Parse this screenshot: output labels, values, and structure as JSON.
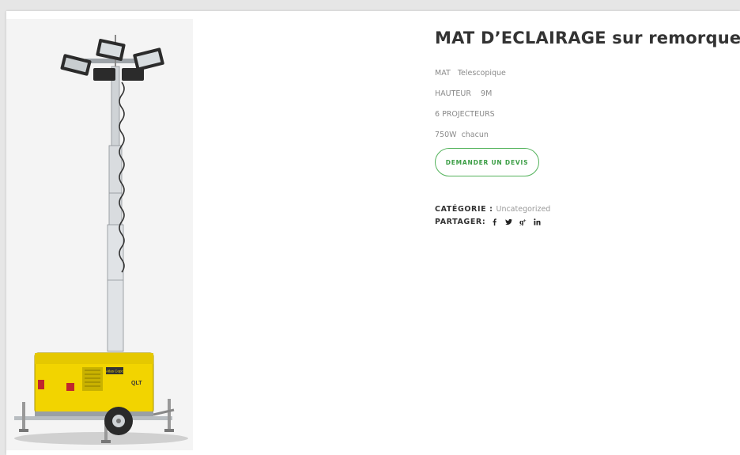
{
  "product": {
    "title": "MAT D’ECLAIRAGE sur remorque",
    "specs": [
      "MAT   Telescopique",
      "HAUTEUR    9M",
      "6 PROJECTEURS",
      "750W  chacun"
    ],
    "cta_label": "DEMANDER UN DEVIS",
    "category_label": "CATÉGORIE :",
    "category_value": "Uncategorized",
    "share_label": "PARTAGER:",
    "share_icons": [
      "facebook-icon",
      "twitter-icon",
      "google-plus-icon",
      "linkedin-icon"
    ],
    "image_brand": "Atlas Copco",
    "image_model": "QLT"
  },
  "colors": {
    "accent": "#3a9d44",
    "title": "#333333",
    "muted": "#8a8a8a",
    "generator_yellow": "#f2d400"
  }
}
